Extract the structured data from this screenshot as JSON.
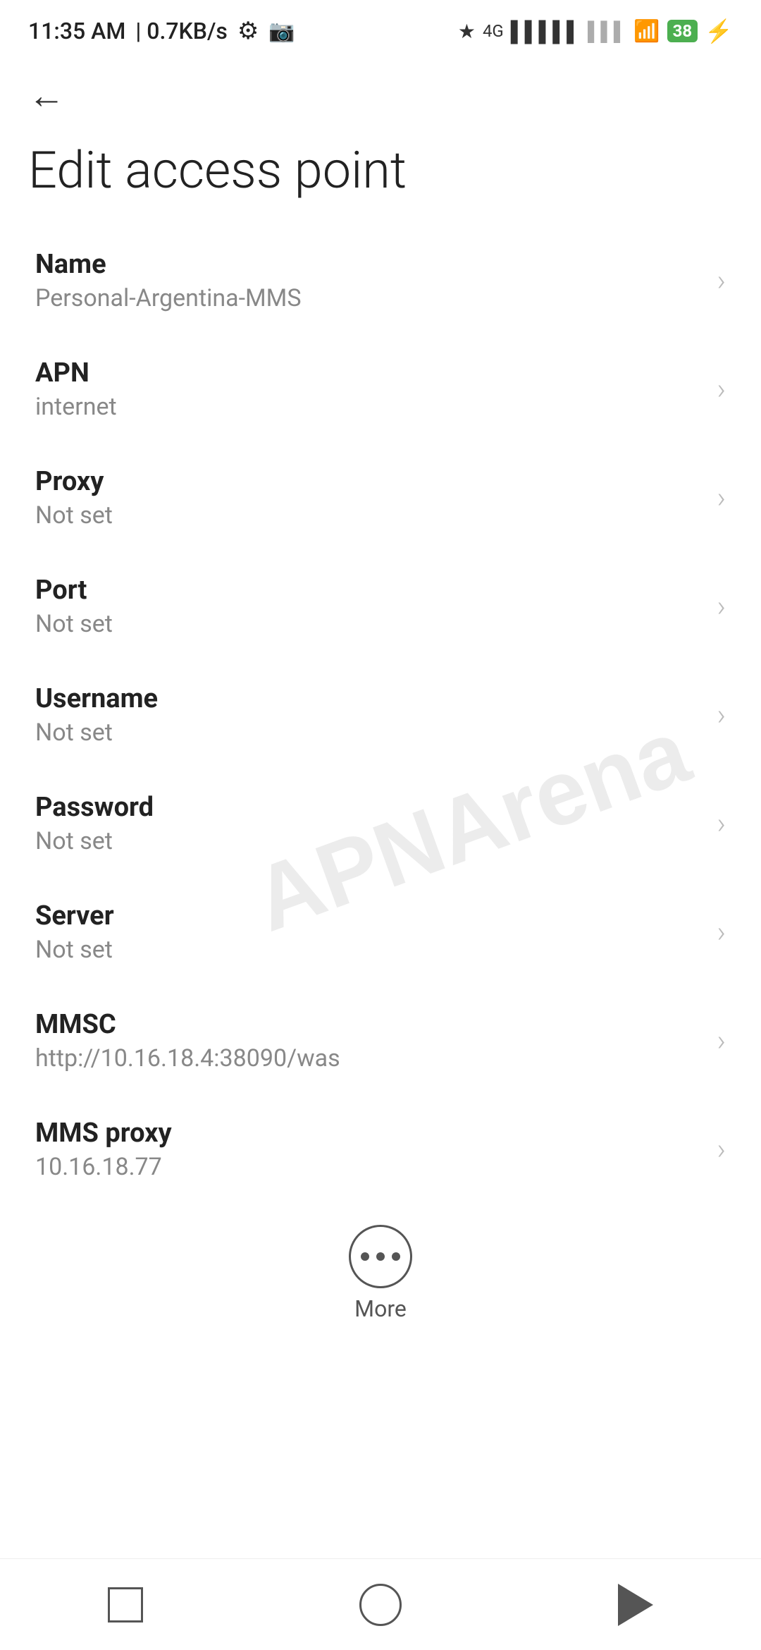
{
  "statusBar": {
    "time": "11:35 AM",
    "speed": "0.7KB/s"
  },
  "page": {
    "title": "Edit access point",
    "backLabel": "Back"
  },
  "settings": [
    {
      "id": "name",
      "label": "Name",
      "value": "Personal-Argentina-MMS"
    },
    {
      "id": "apn",
      "label": "APN",
      "value": "internet"
    },
    {
      "id": "proxy",
      "label": "Proxy",
      "value": "Not set"
    },
    {
      "id": "port",
      "label": "Port",
      "value": "Not set"
    },
    {
      "id": "username",
      "label": "Username",
      "value": "Not set"
    },
    {
      "id": "password",
      "label": "Password",
      "value": "Not set"
    },
    {
      "id": "server",
      "label": "Server",
      "value": "Not set"
    },
    {
      "id": "mmsc",
      "label": "MMSC",
      "value": "http://10.16.18.4:38090/was"
    },
    {
      "id": "mms-proxy",
      "label": "MMS proxy",
      "value": "10.16.18.77"
    }
  ],
  "moreButton": {
    "label": "More"
  },
  "watermark": {
    "text": "APNArena"
  }
}
